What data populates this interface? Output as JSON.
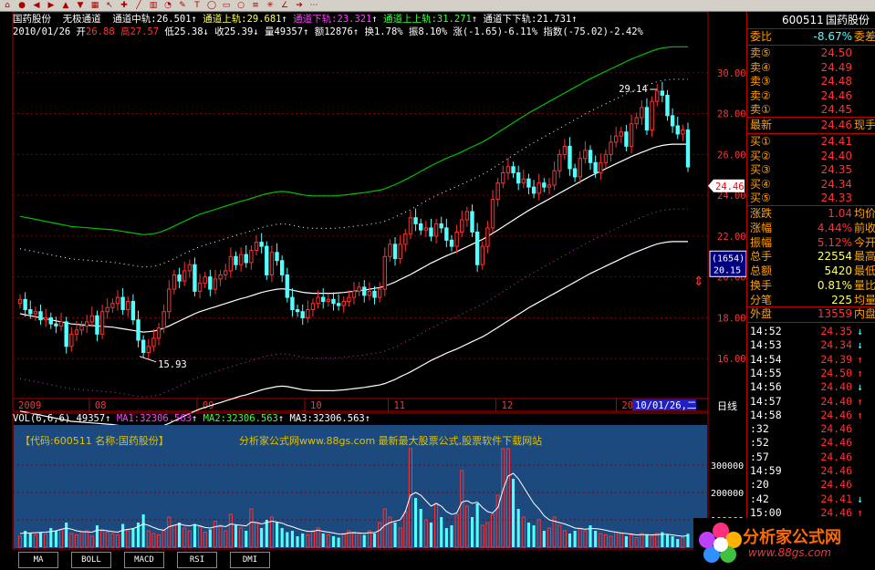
{
  "toolbar": {
    "icons": [
      "home-icon",
      "stop-icon",
      "back-icon",
      "forward-icon",
      "up-icon",
      "down-icon",
      "chart-icon",
      "pointer-icon",
      "cross-icon",
      "line-icon",
      "bars-icon",
      "period-icon",
      "draw-icon",
      "text-icon",
      "ellipse-icon",
      "rect-icon",
      "circle-icon",
      "fib-icon",
      "gann-icon",
      "angle-icon",
      "arrow-icon",
      "more-icon"
    ]
  },
  "header": {
    "stock_name": "国药股份",
    "indicator": "无极通道",
    "mid_label": "通道中轨:",
    "mid_value": "26.501",
    "up_label": "通道上轨:",
    "up_value": "29.681",
    "down_label": "通道下轨:",
    "down_value": "23.321",
    "upup_label": "通道上上轨:",
    "upup_value": "31.271",
    "downdown_label": "通道下下轨:",
    "downdown_value": "21.731",
    "date": "2010/01/26",
    "open_label": "开",
    "open": "26.88",
    "high_label": "高",
    "high": "27.57",
    "low_label": "低",
    "low": "25.38",
    "close_label": "收",
    "close": "25.39",
    "vol_label": "量",
    "vol": "49357",
    "amt_label": "额",
    "amt": "12876",
    "turnover_label": "换",
    "turnover": "1.78%",
    "amp_label": "振",
    "amp": "8.10%",
    "chg_label": "涨",
    "chg": "(-1.65)-6.11%",
    "index_label": "指数",
    "index": "(-75.02)-2.42%"
  },
  "labels": {
    "high_mark": "29.14",
    "low_mark": "15.93",
    "cur_price": "24.46",
    "box_top": "(1654)",
    "box_bottom": "20.15",
    "period": "日线",
    "last_date": "10/01/26,二"
  },
  "vol_header": {
    "name": "VOL(6,6,6)",
    "vol": "49357",
    "ma1_label": "MA1:",
    "ma1": "32306.563",
    "ma2_label": "MA2:",
    "ma2": "32306.563",
    "ma3_label": "MA3:",
    "ma3": "32306.563"
  },
  "vol_ads": {
    "left": "【代码:600511 名称:国药股份】",
    "right": "分析家公式网www.88gs.com 最新最大股票公式,股票软件下载网站"
  },
  "tabs": [
    "MA",
    "BOLL",
    "MACD",
    "RSI",
    "DMI"
  ],
  "panel": {
    "code": "600511",
    "name": "国药股份",
    "weibi_label": "委比",
    "weibi": "-8.67%",
    "weicha_label": "委差",
    "sells": [
      {
        "label": "卖⑤",
        "price": "24.50"
      },
      {
        "label": "卖④",
        "price": "24.49"
      },
      {
        "label": "卖③",
        "price": "24.48"
      },
      {
        "label": "卖②",
        "price": "24.46"
      },
      {
        "label": "卖①",
        "price": "24.45"
      }
    ],
    "latest_label": "最新",
    "latest": "24.46",
    "latest_ext": "现手",
    "buys": [
      {
        "label": "买①",
        "price": "24.41"
      },
      {
        "label": "买②",
        "price": "24.40"
      },
      {
        "label": "买③",
        "price": "24.35"
      },
      {
        "label": "买④",
        "price": "24.34"
      },
      {
        "label": "买⑤",
        "price": "24.33"
      }
    ],
    "stats": [
      {
        "label": "涨跌",
        "value": "1.04",
        "ext": "均价"
      },
      {
        "label": "涨幅",
        "value": "4.44%",
        "ext": "前收"
      },
      {
        "label": "振幅",
        "value": "5.12%",
        "ext": "今开"
      },
      {
        "label": "总手",
        "value": "22554",
        "ext": "最高"
      },
      {
        "label": "总额",
        "value": "5420",
        "ext": "最低"
      },
      {
        "label": "换手",
        "value": "0.81%",
        "ext": "量比"
      },
      {
        "label": "分笔",
        "value": "225",
        "ext": "均量"
      }
    ],
    "outer_label": "外盘",
    "outer": "13559",
    "inner_label": "内盘",
    "ticks": [
      {
        "time": "14:52",
        "price": "24.35",
        "dir": "down"
      },
      {
        "time": "14:53",
        "price": "24.34",
        "dir": "down"
      },
      {
        "time": "14:54",
        "price": "24.39",
        "dir": "up"
      },
      {
        "time": "14:55",
        "price": "24.50",
        "dir": "up"
      },
      {
        "time": "14:56",
        "price": "24.40",
        "dir": "down"
      },
      {
        "time": "14:57",
        "price": "24.40",
        "dir": "up"
      },
      {
        "time": "14:58",
        "price": "24.46",
        "dir": "up"
      },
      {
        "time": ":32",
        "price": "24.46",
        "dir": ""
      },
      {
        "time": ":52",
        "price": "24.46",
        "dir": ""
      },
      {
        "time": ":57",
        "price": "24.46",
        "dir": ""
      },
      {
        "time": "14:59",
        "price": "24.46",
        "dir": ""
      },
      {
        "time": ":20",
        "price": "24.46",
        "dir": ""
      },
      {
        "time": ":42",
        "price": "24.41",
        "dir": "down"
      },
      {
        "time": "15:00",
        "price": "24.46",
        "dir": "up"
      }
    ]
  },
  "logo": {
    "title": "分析家公式网",
    "url": "www.88gs.com"
  },
  "colors": {
    "up": "#ff3232",
    "down": "#54ffff",
    "mid": "#ffffff",
    "band": "#00c000",
    "dot_up": "#ffffff",
    "dot_down": "#c040c0",
    "grid": "#800000",
    "axis": "#b00000"
  },
  "chart_data": [
    {
      "type": "candlestick",
      "ylim": [
        14.0,
        32.0
      ],
      "yticks": [
        "16.00",
        "18.00",
        "20.00",
        "22.00",
        "24.00",
        "26.00",
        "28.00",
        "30.00"
      ],
      "x_labels": [
        "2009",
        "08",
        "09",
        "10",
        "11",
        "12",
        "2010"
      ],
      "annotations": [
        {
          "text": "29.14",
          "kind": "high"
        },
        {
          "text": "15.93",
          "kind": "low"
        }
      ],
      "series_close": [
        18.9,
        18.4,
        18.2,
        18.3,
        17.9,
        18.0,
        17.7,
        17.6,
        17.8,
        16.6,
        17.2,
        17.4,
        17.6,
        17.8,
        18.1,
        17.2,
        18.3,
        18.5,
        18.7,
        19.0,
        18.4,
        18.8,
        17.9,
        16.9,
        16.3,
        16.6,
        17.0,
        17.5,
        18.3,
        19.4,
        20.1,
        19.8,
        20.3,
        20.6,
        19.3,
        19.7,
        20.0,
        19.4,
        19.9,
        20.1,
        20.3,
        21.0,
        20.6,
        21.1,
        20.7,
        21.3,
        21.7,
        21.5,
        20.1,
        21.2,
        20.8,
        20.1,
        19.0,
        18.4,
        18.3,
        18.0,
        18.4,
        18.7,
        19.0,
        18.8,
        18.9,
        18.7,
        18.6,
        18.8,
        19.0,
        19.3,
        19.5,
        19.1,
        19.3,
        19.0,
        19.4,
        21.0,
        21.6,
        20.9,
        21.6,
        22.1,
        22.9,
        22.6,
        22.3,
        22.4,
        22.0,
        22.6,
        22.4,
        21.8,
        21.5,
        22.2,
        22.8,
        23.2,
        22.2,
        20.6,
        21.5,
        22.4,
        23.8,
        24.6,
        25.1,
        25.4,
        25.1,
        24.6,
        24.8,
        24.4,
        24.1,
        24.6,
        24.4,
        24.5,
        25.2,
        26.0,
        26.4,
        25.3,
        24.9,
        25.8,
        26.2,
        25.6,
        25.1,
        25.6,
        26.0,
        26.6,
        26.9,
        27.1,
        26.4,
        27.5,
        27.8,
        28.3,
        27.2,
        28.6,
        29.1,
        28.9,
        27.9,
        27.4,
        27.0,
        27.2,
        25.39
      ],
      "mid_line": [
        18.2,
        18.15,
        18.1,
        18.05,
        18.0,
        17.95,
        17.9,
        17.85,
        17.8,
        17.75,
        17.7,
        17.68,
        17.66,
        17.64,
        17.62,
        17.6,
        17.58,
        17.56,
        17.54,
        17.5,
        17.46,
        17.42,
        17.38,
        17.34,
        17.3,
        17.32,
        17.35,
        17.4,
        17.5,
        17.6,
        17.72,
        17.84,
        17.96,
        18.08,
        18.2,
        18.3,
        18.38,
        18.46,
        18.54,
        18.62,
        18.7,
        18.78,
        18.86,
        18.94,
        19.0,
        19.08,
        19.16,
        19.24,
        19.3,
        19.35,
        19.4,
        19.42,
        19.4,
        19.35,
        19.3,
        19.25,
        19.22,
        19.2,
        19.2,
        19.2,
        19.2,
        19.2,
        19.22,
        19.24,
        19.27,
        19.3,
        19.33,
        19.36,
        19.4,
        19.44,
        19.48,
        19.55,
        19.65,
        19.75,
        19.88,
        20.0,
        20.12,
        20.26,
        20.4,
        20.54,
        20.68,
        20.8,
        20.92,
        21.04,
        21.14,
        21.24,
        21.36,
        21.48,
        21.6,
        21.72,
        21.84,
        21.98,
        22.14,
        22.3,
        22.46,
        22.62,
        22.78,
        22.94,
        23.1,
        23.26,
        23.4,
        23.54,
        23.68,
        23.82,
        23.96,
        24.1,
        24.24,
        24.38,
        24.52,
        24.66,
        24.8,
        24.94,
        25.06,
        25.18,
        25.3,
        25.42,
        25.54,
        25.66,
        25.78,
        25.9,
        26.0,
        26.1,
        26.2,
        26.3,
        26.38,
        26.44,
        26.48,
        26.5,
        26.5,
        26.5,
        26.501
      ],
      "band_offset_up": 3.18,
      "band_offset_down": 3.18,
      "band_offset_upup": 4.77,
      "band_offset_downdown": 4.77
    },
    {
      "type": "bar",
      "title": "VOL(6,6,6)",
      "yticks": [
        "100000",
        "200000",
        "300000"
      ],
      "ylim": [
        0,
        400000
      ],
      "values": [
        40000,
        60000,
        50000,
        45000,
        55000,
        48000,
        70000,
        60000,
        65000,
        90000,
        50000,
        45000,
        55000,
        60000,
        40000,
        80000,
        60000,
        55000,
        50000,
        45000,
        85000,
        60000,
        70000,
        90000,
        120000,
        60000,
        50000,
        45000,
        60000,
        110000,
        80000,
        90000,
        70000,
        60000,
        85000,
        75000,
        55000,
        65000,
        95000,
        80000,
        60000,
        120000,
        80000,
        70000,
        60000,
        140000,
        90000,
        70000,
        100000,
        110000,
        90000,
        70000,
        55000,
        60000,
        40000,
        50000,
        45000,
        60000,
        70000,
        50000,
        45000,
        40000,
        35000,
        50000,
        60000,
        55000,
        50000,
        45000,
        60000,
        50000,
        90000,
        140000,
        110000,
        90000,
        70000,
        130000,
        360000,
        180000,
        140000,
        100000,
        90000,
        160000,
        110000,
        70000,
        80000,
        120000,
        280000,
        150000,
        110000,
        160000,
        80000,
        90000,
        120000,
        190000,
        360000,
        360000,
        250000,
        140000,
        110000,
        90000,
        80000,
        100000,
        60000,
        70000,
        110000,
        80000,
        60000,
        50000,
        60000,
        70000,
        60000,
        80000,
        60000,
        50000,
        45000,
        40000,
        55000,
        50000,
        40000,
        45000,
        35000,
        50000,
        45000,
        40000,
        50000,
        55000,
        45000,
        40000,
        30000,
        35000,
        49357
      ],
      "ma_line": [
        50000,
        52000,
        52000,
        53000,
        54000,
        55000,
        57000,
        60000,
        65000,
        70000,
        66000,
        60000,
        57000,
        56000,
        55000,
        62000,
        63000,
        60000,
        57000,
        55000,
        62000,
        65000,
        68000,
        75000,
        85000,
        80000,
        72000,
        65000,
        62000,
        75000,
        80000,
        85000,
        80000,
        78000,
        82000,
        78000,
        72000,
        70000,
        75000,
        78000,
        75000,
        85000,
        82000,
        80000,
        78000,
        92000,
        90000,
        85000,
        90000,
        95000,
        92000,
        88000,
        80000,
        75000,
        68000,
        62000,
        58000,
        58000,
        62000,
        58000,
        55000,
        52000,
        48000,
        48000,
        52000,
        53000,
        52000,
        51000,
        53000,
        53000,
        62000,
        80000,
        90000,
        95000,
        100000,
        130000,
        190000,
        200000,
        190000,
        170000,
        150000,
        160000,
        150000,
        130000,
        120000,
        125000,
        165000,
        170000,
        160000,
        165000,
        145000,
        130000,
        125000,
        145000,
        210000,
        260000,
        270000,
        250000,
        220000,
        190000,
        160000,
        140000,
        115000,
        100000,
        95000,
        90000,
        85000,
        78000,
        70000,
        68000,
        66000,
        68000,
        68000,
        66000,
        62000,
        58000,
        55000,
        52000,
        50000,
        48000,
        45000,
        46000,
        46000,
        45000,
        46000,
        47000,
        47000,
        45000,
        42000,
        40000,
        42000
      ]
    }
  ]
}
